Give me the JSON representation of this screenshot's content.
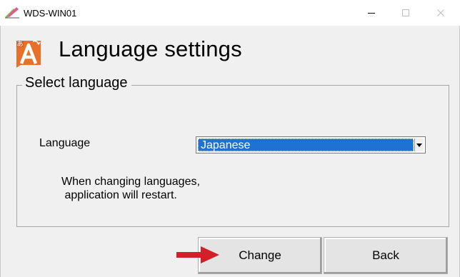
{
  "window": {
    "title": "WDS-WIN01",
    "controls": {
      "minimize": "minimize-icon",
      "maximize": "maximize-icon",
      "close": "close-icon"
    }
  },
  "header": {
    "title": "Language settings",
    "icon": "language-settings-icon"
  },
  "group": {
    "legend": "Select language",
    "language_label": "Language",
    "selected_language": "Japanese",
    "notice_line1": "When changing languages,",
    "notice_line2": " application will restart."
  },
  "buttons": {
    "change": "Change",
    "back": "Back"
  },
  "colors": {
    "selection": "#1e73d2",
    "icon_orange": "#e8702a",
    "arrow_red": "#d21f2a",
    "background": "#f0f0f0"
  }
}
